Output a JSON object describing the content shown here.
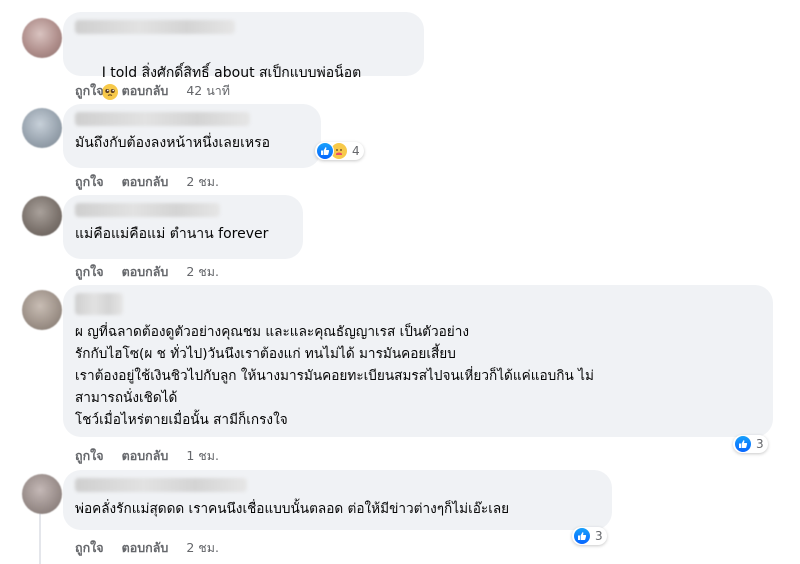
{
  "labels": {
    "like": "ถูกใจ",
    "reply": "ตอบกลับ"
  },
  "comments": [
    {
      "text": "I told สิ่งศักดิ์สิทธิ์ about สเป็กแบบพ่อน็อต",
      "time": "42 นาที",
      "emoji": "pleading-face"
    },
    {
      "text": "มันถึงกับต้องลงหน้าหนึ่งเลยเหรอ",
      "time": "2 ชม.",
      "reaction_count": "4",
      "reactions": [
        "like",
        "care"
      ]
    },
    {
      "text": "แม่คือแม่คือแม่ ตำนาน forever",
      "time": "2 ชม."
    },
    {
      "text": "ผ ญที่ฉลาดต้องดูตัวอย่างคุณชม และและคุณธัญญาเรส เป็นตัวอย่าง\nรักกับไฮโซ(ผ ช ทั่วไป)วันนึงเราต้องแก่ ทนไม่ได้ มารมันคอยเสี้ยบ\nเราต้องอยู่ใช้เงินชิวไปกับลูก ให้นางมารมันคอยทะเบียนสมรสไปจนเหี่ยวก็ได้แค่แอบกิน ไม่\nสามารถนั่งเชิดได้\nโชว์เมื่อไหร่ตายเมื่อนั้น สามีก็เกรงใจ",
      "time": "1 ชม.",
      "reaction_count": "3",
      "reactions": [
        "like"
      ]
    },
    {
      "text": "พ่อคลั่งรักแม่สุดดด เราคนนึงเชื่อแบบนั้นตลอด ต่อให้มีข่าวต่างๆก็ไม่เอ๊ะเลย",
      "time": "2 ชม.",
      "reaction_count": "3",
      "reactions": [
        "like"
      ]
    }
  ],
  "colors": {
    "bubble": "#f0f2f5",
    "meta": "#65676b",
    "like_blue": "#0866ff"
  }
}
